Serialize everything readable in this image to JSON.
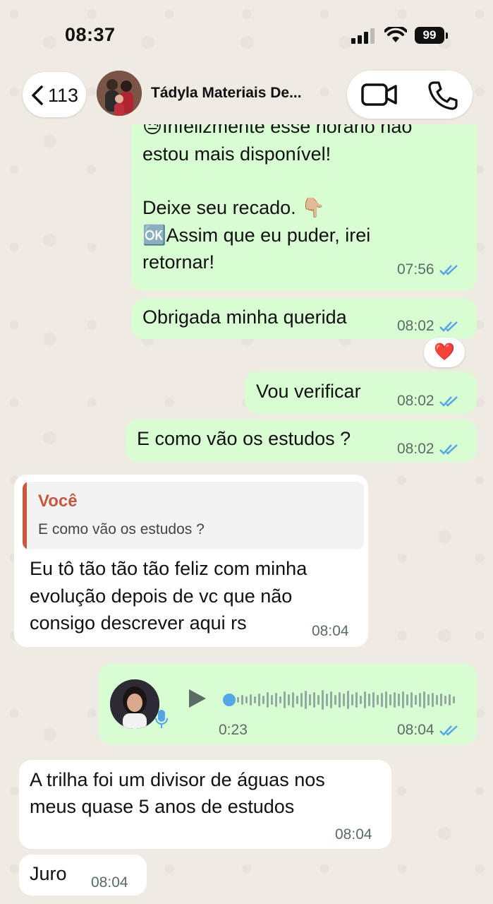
{
  "status_bar": {
    "time": "08:37",
    "battery": "99"
  },
  "header": {
    "back_count": "113",
    "contact_name": "Tádyla Materiais De..."
  },
  "messages": [
    {
      "text_lines": [
        "😓Infelizmente esse horário não",
        "estou mais disponível!",
        "",
        "Deixe seu recado. 👇🏼",
        "🆗Assim que eu puder,  irei",
        "retornar!"
      ],
      "time": "07:56"
    },
    {
      "text": "Obrigada minha querida",
      "time": "08:02",
      "reaction": "❤️"
    },
    {
      "text": "Vou verificar",
      "time": "08:02"
    },
    {
      "text": "E como vão os estudos ?",
      "time": "08:02"
    },
    {
      "quote_author": "Você",
      "quote_text": "E como vão os estudos ?",
      "text_lines": [
        "Eu tô tão tão tão feliz com minha",
        "evolução depois de vc que não",
        "consigo descrever aqui rs"
      ],
      "time": "08:04"
    },
    {
      "voice_duration": "0:23",
      "time": "08:04"
    },
    {
      "text_lines": [
        "A trilha foi um divisor de águas nos",
        "meus quase 5 anos de estudos"
      ],
      "time": "08:04"
    },
    {
      "text": "Juro",
      "time": "08:04"
    }
  ],
  "colors": {
    "outgoing": "#d9fdd3",
    "incoming": "#ffffff",
    "read_ticks": "#53a6e8",
    "quote_accent": "#c8573d"
  }
}
